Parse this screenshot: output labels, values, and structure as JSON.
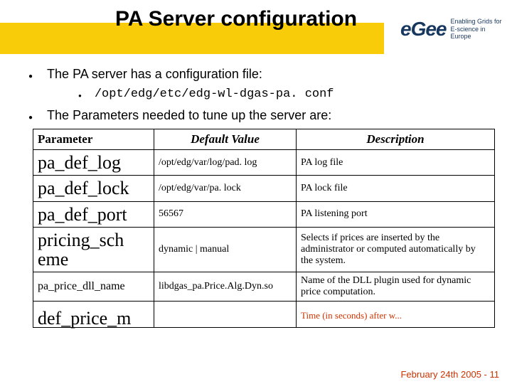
{
  "header": {
    "title": "PA Server configuration",
    "logo": {
      "mark": "eGee",
      "line1": "Enabling Grids for",
      "line2": "E-science in Europe"
    }
  },
  "bullets": {
    "b1": "The PA server has a configuration file:",
    "b1a": "/opt/edg/etc/edg-wl-dgas-pa. conf",
    "b2": "The Parameters needed to tune up the server are:"
  },
  "table": {
    "h1": "Parameter",
    "h2": "Default Value",
    "h3": "Description",
    "rows": [
      {
        "p": "pa_def_log",
        "v": "/opt/edg/var/log/pad. log",
        "d": "PA log file",
        "big": true
      },
      {
        "p": "pa_def_lock",
        "v": "/opt/edg/var/pa. lock",
        "d": "PA lock file",
        "big": true
      },
      {
        "p": "pa_def_port",
        "v": "56567",
        "d": "PA listening port",
        "big": true
      },
      {
        "p": "pricing_sch eme",
        "v": "dynamic | manual",
        "d": "Selects if prices are inserted by the administrator or computed automatically by the system.",
        "big": true
      },
      {
        "p": "pa_price_dll_name",
        "v": "libdgas_pa.Price.Alg.Dyn.so",
        "d": "Name of the DLL plugin used for dynamic price computation.",
        "big": false
      }
    ],
    "cutRow": {
      "p": "def_price_m",
      "v": "",
      "d": "Time (in seconds) after w..."
    }
  },
  "footer": {
    "date": "February 24th  2005 - 11"
  }
}
